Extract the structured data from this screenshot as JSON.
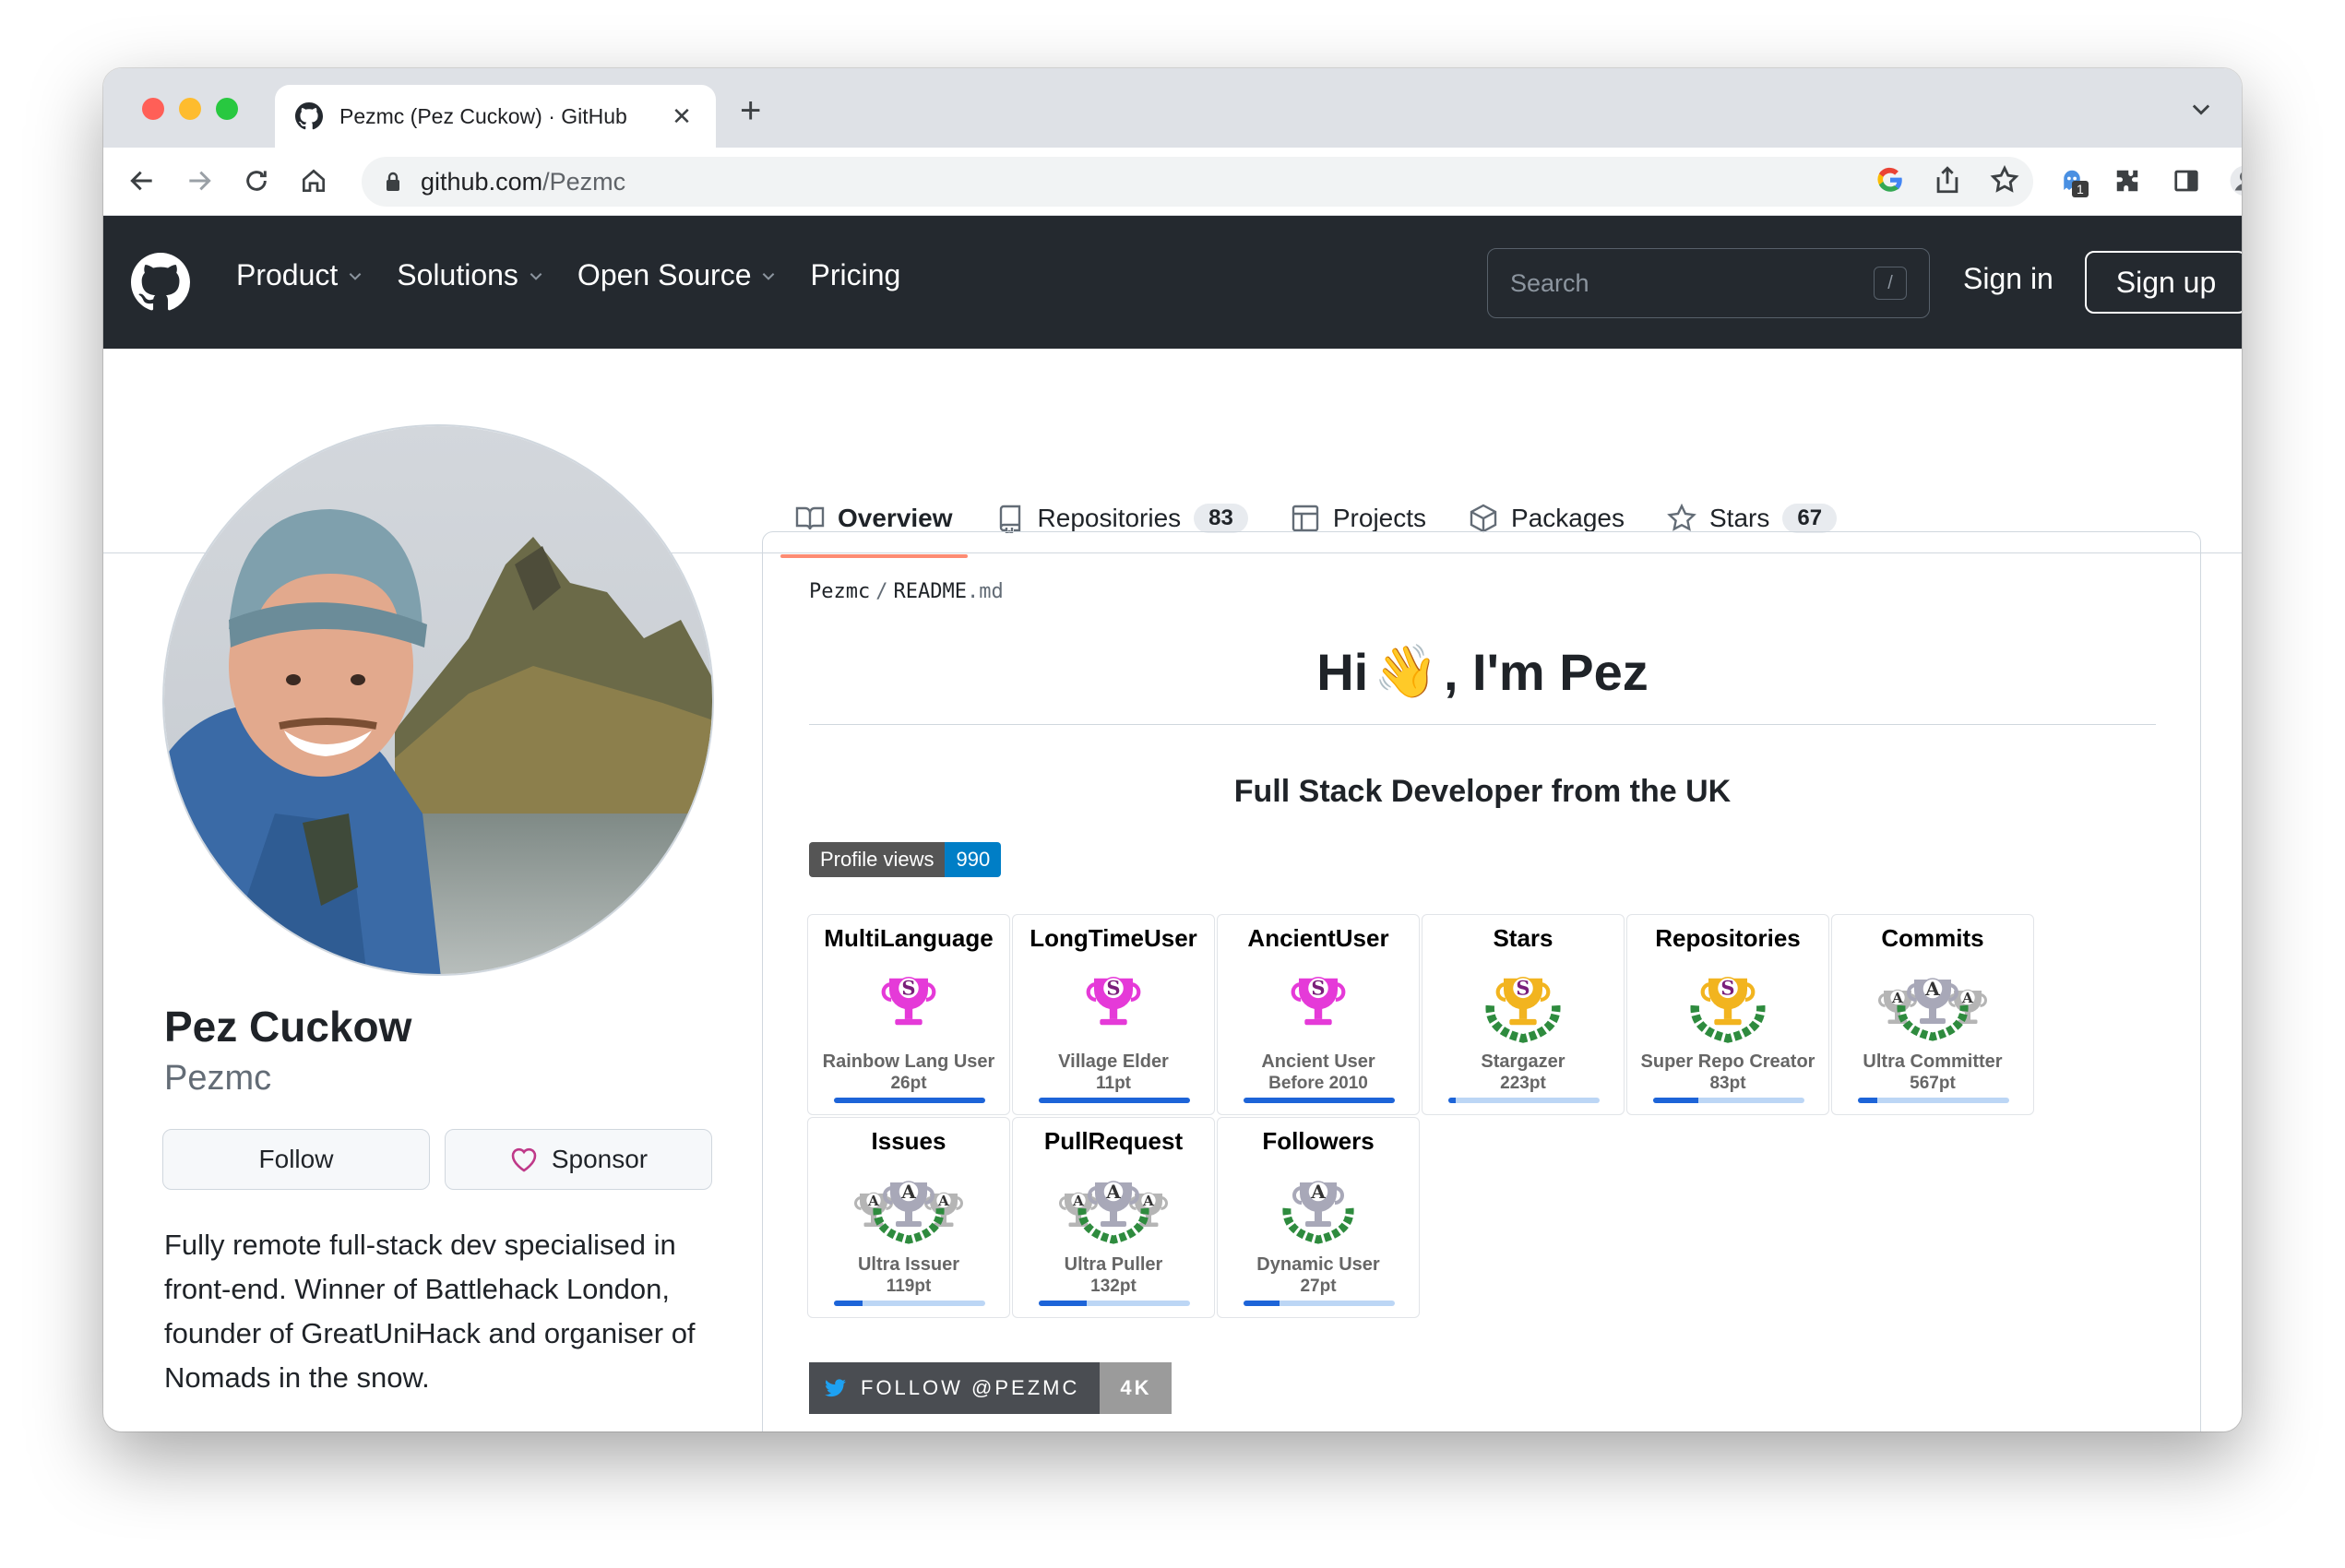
{
  "browser": {
    "tab_title": "Pezmc (Pez Cuckow) · GitHub",
    "new_tab": "+",
    "close": "✕",
    "url_domain": "github.com",
    "url_path": "/Pezmc",
    "extension_badge": "1"
  },
  "header": {
    "nav": [
      {
        "label": "Product",
        "dropdown": true
      },
      {
        "label": "Solutions",
        "dropdown": true
      },
      {
        "label": "Open Source",
        "dropdown": true
      },
      {
        "label": "Pricing",
        "dropdown": false
      }
    ],
    "search_placeholder": "Search",
    "search_key": "/",
    "sign_in": "Sign in",
    "sign_up": "Sign up"
  },
  "profile_tabs": [
    {
      "label": "Overview",
      "count": "",
      "icon": "book-icon",
      "active": true
    },
    {
      "label": "Repositories",
      "count": "83",
      "icon": "repo-icon",
      "active": false
    },
    {
      "label": "Projects",
      "count": "",
      "icon": "table-icon",
      "active": false
    },
    {
      "label": "Packages",
      "count": "",
      "icon": "package-icon",
      "active": false
    },
    {
      "label": "Stars",
      "count": "67",
      "icon": "star-icon",
      "active": false
    }
  ],
  "sidebar": {
    "name": "Pez Cuckow",
    "login": "Pezmc",
    "follow": "Follow",
    "sponsor": "Sponsor",
    "bio": "Fully remote full-stack dev specialised in front-end. Winner of Battlehack London, founder of GreatUniHack and organiser of Nomads in the snow."
  },
  "readme": {
    "path_user": "Pezmc",
    "path_sep": "/",
    "path_file": "README",
    "path_ext": ".md",
    "heading_pre": "Hi",
    "heading_emoji": "👋",
    "heading_post": ", I'm Pez",
    "subheading": "Full Stack Developer from the UK",
    "views_label": "Profile views",
    "views_value": "990",
    "twitter_label": "FOLLOW @PEZMC",
    "twitter_value": "4K"
  },
  "trophies": [
    {
      "title": "MultiLanguage",
      "rank": "Rainbow Lang User",
      "points": "26pt",
      "grade": "S",
      "progress": 1.0,
      "color": "#e53ad8"
    },
    {
      "title": "LongTimeUser",
      "rank": "Village Elder",
      "points": "11pt",
      "grade": "S",
      "progress": 1.0,
      "color": "#e53ad8"
    },
    {
      "title": "AncientUser",
      "rank": "Ancient User\nBefore 2010",
      "points": "",
      "grade": "S",
      "progress": 1.0,
      "color": "#e53ad8"
    },
    {
      "title": "Stars",
      "rank": "Stargazer",
      "points": "223pt",
      "grade": "S",
      "progress": 0.05,
      "color": "#f2b41f"
    },
    {
      "title": "Repositories",
      "rank": "Super Repo Creator",
      "points": "83pt",
      "grade": "S",
      "progress": 0.3,
      "color": "#f2b41f"
    },
    {
      "title": "Commits",
      "rank": "Ultra Committer",
      "points": "567pt",
      "grade": "AAA",
      "progress": 0.13,
      "color": "#a8a8a8"
    },
    {
      "title": "Issues",
      "rank": "Ultra Issuer",
      "points": "119pt",
      "grade": "AAA",
      "progress": 0.19,
      "color": "#a8a8a8"
    },
    {
      "title": "PullRequest",
      "rank": "Ultra Puller",
      "points": "132pt",
      "grade": "AAA",
      "progress": 0.32,
      "color": "#a8a8a8"
    },
    {
      "title": "Followers",
      "rank": "Dynamic User",
      "points": "27pt",
      "grade": "A",
      "progress": 0.24,
      "color": "#a8a8a8"
    }
  ]
}
